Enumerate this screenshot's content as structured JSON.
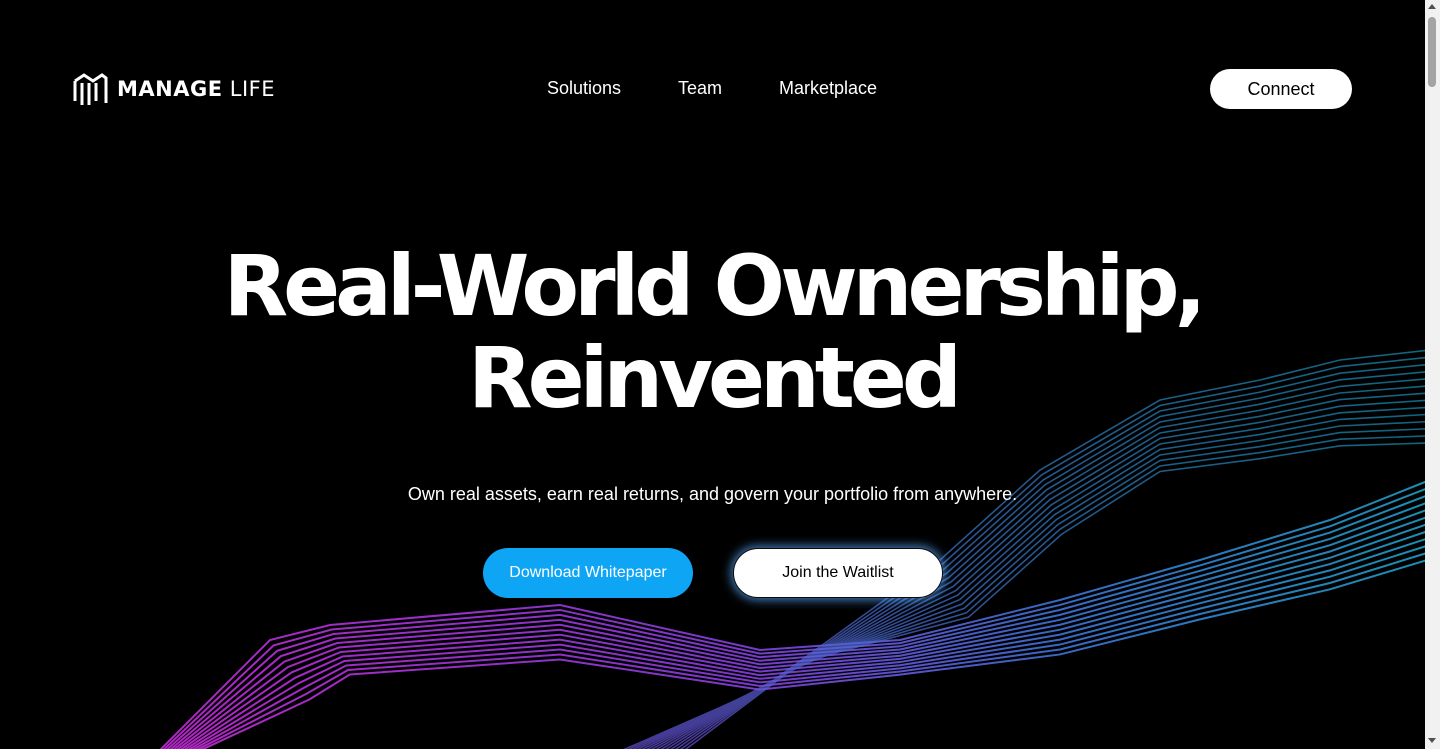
{
  "header": {
    "logo": {
      "bold_text": "MANAGE",
      "light_text": "LIFE",
      "icon": "managelife-logo-icon"
    },
    "nav": [
      {
        "label": "Solutions"
      },
      {
        "label": "Team"
      },
      {
        "label": "Marketplace"
      }
    ],
    "connect_label": "Connect"
  },
  "hero": {
    "title_line1": "Real-World Ownership,",
    "title_line2": "Reinvented",
    "subtitle": "Own real assets, earn real returns, and govern your portfolio from anywhere.",
    "primary_cta": "Download Whitepaper",
    "secondary_cta": "Join the Waitlist"
  },
  "colors": {
    "background": "#000000",
    "accent_blue": "#0ea5f5",
    "wave_magenta": "#c22ad8",
    "wave_blue": "#2f7fd0",
    "wave_teal": "#1fa3c4"
  }
}
